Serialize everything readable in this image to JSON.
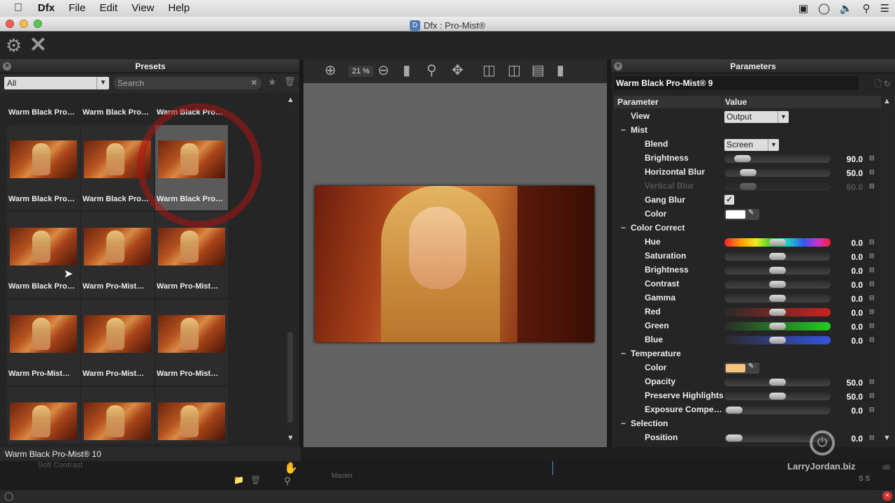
{
  "menubar": {
    "apple": "",
    "app": "Dfx",
    "items": [
      "File",
      "Edit",
      "View",
      "Help"
    ],
    "status_icons": [
      "camera-icon",
      "creative-cloud-icon",
      "volume-icon",
      "search-icon",
      "list-icon"
    ]
  },
  "window": {
    "title": "Dfx : Pro-Mist®"
  },
  "toolbar": {
    "settings_icon": "gear-icon",
    "close_icon": "close-x-icon"
  },
  "presets": {
    "header": "Presets",
    "filter_value": "All",
    "search_placeholder": "Search",
    "top_row": [
      "Warm Black Pro…",
      "Warm Black Pro…",
      "Warm Black Pro…"
    ],
    "rows": [
      [
        "Warm Black Pro…",
        "Warm Black Pro…",
        "Warm Black Pro…"
      ],
      [
        "Warm Black Pro…",
        "Warm Pro-Mist…",
        "Warm Pro-Mist…"
      ],
      [
        "Warm Pro-Mist…",
        "Warm Pro-Mist…",
        "Warm Pro-Mist…"
      ],
      [
        "",
        "",
        ""
      ]
    ],
    "selected_status": "Warm Black Pro-Mist® 10"
  },
  "viewer": {
    "zoom": "21 %"
  },
  "parameters": {
    "header": "Parameters",
    "preset_name": "Warm Black Pro-Mist® 9",
    "col_param": "Parameter",
    "col_value": "Value",
    "view_label": "View",
    "view_value": "Output",
    "mist_group": "Mist",
    "blend_label": "Blend",
    "blend_value": "Screen",
    "brightness_label": "Brightness",
    "brightness_value": "90.0",
    "hblur_label": "Horizontal Blur",
    "hblur_value": "50.0",
    "vblur_label": "Vertical Blur",
    "vblur_value": "50.0",
    "gang_label": "Gang Blur",
    "color_label": "Color",
    "color_value": "#ffffff",
    "cc_group": "Color Correct",
    "hue_label": "Hue",
    "hue_value": "0.0",
    "sat_label": "Saturation",
    "sat_value": "0.0",
    "bri2_label": "Brightness",
    "bri2_value": "0.0",
    "con_label": "Contrast",
    "con_value": "0.0",
    "gam_label": "Gamma",
    "gam_value": "0.0",
    "red_label": "Red",
    "red_value": "0.0",
    "green_label": "Green",
    "green_value": "0.0",
    "blue_label": "Blue",
    "blue_value": "0.0",
    "temp_group": "Temperature",
    "tcolor_label": "Color",
    "tcolor_value": "#f7c27a",
    "opacity_label": "Opacity",
    "opacity_value": "50.0",
    "preserve_label": "Preserve Highlights",
    "preserve_value": "50.0",
    "exposure_label": "Exposure Compe…",
    "exposure_value": "0.0",
    "sel_group": "Selection",
    "pos_label": "Position",
    "pos_value": "0.0"
  },
  "background": {
    "soft_contrast": "Soft Contrast",
    "master": "Master",
    "watermark": "LarryJordan.biz",
    "db": "dB",
    "ss": "S  S"
  }
}
